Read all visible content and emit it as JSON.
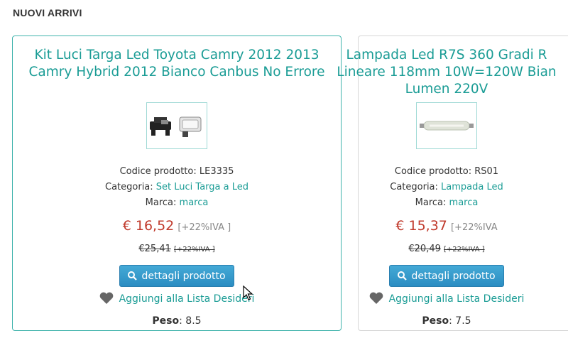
{
  "section": {
    "title": "NUOVI ARRIVI"
  },
  "labels": {
    "code": "Codice prodotto: ",
    "category": "Categoria: ",
    "brand": "Marca: ",
    "details_button": "dettagli prodotto",
    "wishlist": "Aggiungi alla Lista Desideri",
    "weight": "Peso"
  },
  "products": [
    {
      "title": "Kit Luci Targa Led Toyota Camry 2012 2013\nCamry Hybrid 2012 Bianco Canbus No Errore",
      "code": "LE3335",
      "category": "Set Luci Targa a Led",
      "brand": "marca",
      "price": "€ 16,52",
      "vat": "[+22%IVA ]",
      "old_price": "€25,41",
      "old_vat": "[+22%IVA ]",
      "weight": ": 8.5"
    },
    {
      "title": "Lampada Led R7S 360 Gradi R\nLineare 118mm 10W=120W Bian\nLumen 220V",
      "code": "RS01",
      "category": "Lampada Led",
      "brand": "marca",
      "price": "€ 15,37",
      "vat": "[+22%IVA",
      "old_price": "€20,49",
      "old_vat": "[+22%IVA ]",
      "weight": ": 7.5"
    }
  ],
  "colors": {
    "accent": "#1a9c95",
    "price": "#c0392b",
    "button": "#2b8dc2"
  },
  "icons": {
    "details": "zoom-icon",
    "wishlist": "heart-icon"
  }
}
